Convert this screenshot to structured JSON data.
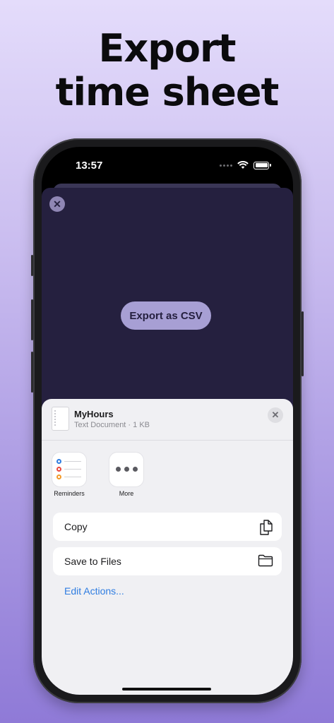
{
  "headline": {
    "line1": "Export",
    "line2": "time sheet"
  },
  "status_bar": {
    "time": "13:57"
  },
  "app_screen": {
    "close_label": "✕",
    "export_button_label": "Export as CSV"
  },
  "share_sheet": {
    "document": {
      "name": "MyHours",
      "meta": "Text Document · 1 KB"
    },
    "close_label": "✕",
    "apps": [
      {
        "label": "Reminders"
      },
      {
        "label": "More"
      }
    ],
    "actions": [
      {
        "label": "Copy"
      },
      {
        "label": "Save to Files"
      }
    ],
    "edit_actions_label": "Edit Actions..."
  },
  "colors": {
    "app_background": "#25203f",
    "button_fill": "#a79fd4",
    "link": "#2f7de1",
    "reminder_blue": "#2f7de1",
    "reminder_red": "#e9473c",
    "reminder_orange": "#f39a28"
  }
}
